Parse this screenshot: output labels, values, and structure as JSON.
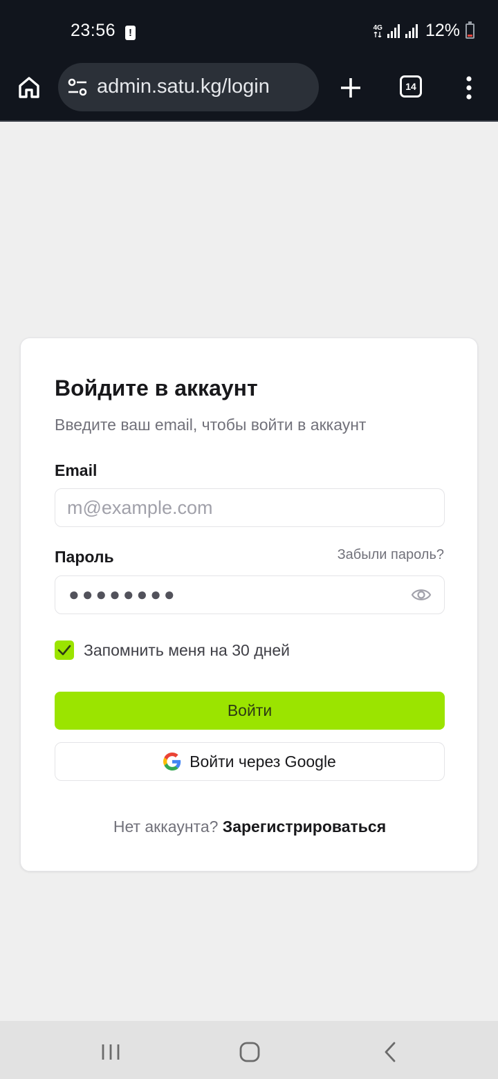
{
  "status_bar": {
    "time": "23:56",
    "alert_icon": "!",
    "network_type": "4G",
    "battery_percent": "12%",
    "battery_level": 0.12
  },
  "browser": {
    "url": "admin.satu.kg/login",
    "tab_count": "14"
  },
  "login_card": {
    "title": "Войдите в аккаунт",
    "subtitle": "Введите ваш email, чтобы войти в аккаунт",
    "email_label": "Email",
    "email_placeholder": "m@example.com",
    "password_label": "Пароль",
    "forgot_password": "Забыли пароль?",
    "password_value": "●●●●●●●●",
    "remember_label": "Запомнить меня на 30 дней",
    "remember_checked": true,
    "login_button": "Войти",
    "google_button": "Войти через Google",
    "signup_prompt": "Нет аккаунта?",
    "signup_link": "Зарегистрироваться"
  },
  "colors": {
    "accent": "#9be400",
    "status_bar_bg": "#11151d",
    "page_bg": "#efefef"
  },
  "icons": {
    "home": "home-icon",
    "site_settings": "tune-icon",
    "new_tab": "plus-icon",
    "tabs": "tab-switcher-icon",
    "menu": "more-vert-icon",
    "show_password": "eye-icon",
    "checkbox": "check-icon",
    "google": "google-logo-icon",
    "nav_recent": "recent-apps-icon",
    "nav_home": "home-circle-icon",
    "nav_back": "back-icon"
  }
}
